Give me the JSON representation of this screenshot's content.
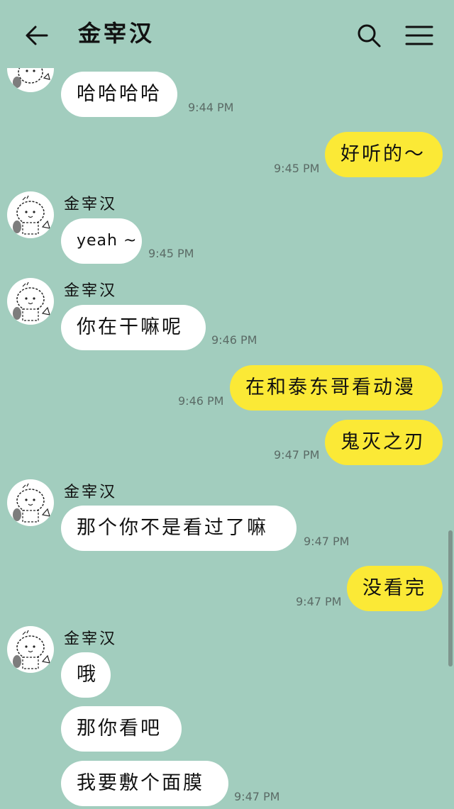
{
  "header": {
    "title": "金宰汉",
    "back_icon": "arrow-left-icon",
    "search_icon": "search-icon",
    "menu_icon": "hamburger-menu-icon"
  },
  "contact_name": "金宰汉",
  "colors": {
    "background": "#a2cdbe",
    "incoming_bubble": "#ffffff",
    "outgoing_bubble": "#fbe936"
  },
  "messages": [
    {
      "direction": "in",
      "text": "哈哈哈哈",
      "time": "9:44 PM"
    },
    {
      "direction": "out",
      "text": "好听的～",
      "time": "9:45 PM"
    },
    {
      "direction": "in",
      "sender": "金宰汉",
      "text": "yeah ~",
      "time": "9:45 PM"
    },
    {
      "direction": "in",
      "sender": "金宰汉",
      "text": "你在干嘛呢",
      "time": "9:46 PM"
    },
    {
      "direction": "out",
      "text": "在和泰东哥看动漫",
      "time": "9:46 PM"
    },
    {
      "direction": "out",
      "text": "鬼灭之刃",
      "time": "9:47 PM"
    },
    {
      "direction": "in",
      "sender": "金宰汉",
      "text": "那个你不是看过了嘛",
      "time": "9:47 PM"
    },
    {
      "direction": "out",
      "text": "没看完",
      "time": "9:47 PM"
    },
    {
      "direction": "in",
      "sender": "金宰汉",
      "text": "哦",
      "time": ""
    },
    {
      "direction": "in",
      "text": "那你看吧",
      "time": ""
    },
    {
      "direction": "in",
      "text": "我要敷个面膜",
      "time": "9:47 PM"
    }
  ]
}
